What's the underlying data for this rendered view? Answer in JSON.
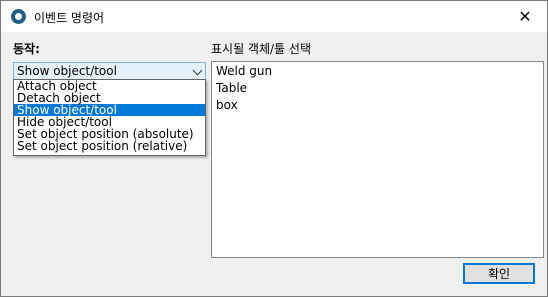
{
  "window": {
    "title": "이벤트 명령어",
    "close_label": "✕"
  },
  "action": {
    "label": "동작:",
    "selected": "Show object/tool",
    "options": [
      "Attach object",
      "Detach object",
      "Show object/tool",
      "Hide object/tool",
      "Set object position (absolute)",
      "Set object position (relative)"
    ]
  },
  "targets": {
    "label": "표시될 객체/툴 선택",
    "items": [
      "Weld gun",
      "Table",
      "box"
    ]
  },
  "buttons": {
    "ok": "확인"
  },
  "colors": {
    "selection": "#0078d7",
    "combo_bg": "#e5f1fb"
  }
}
